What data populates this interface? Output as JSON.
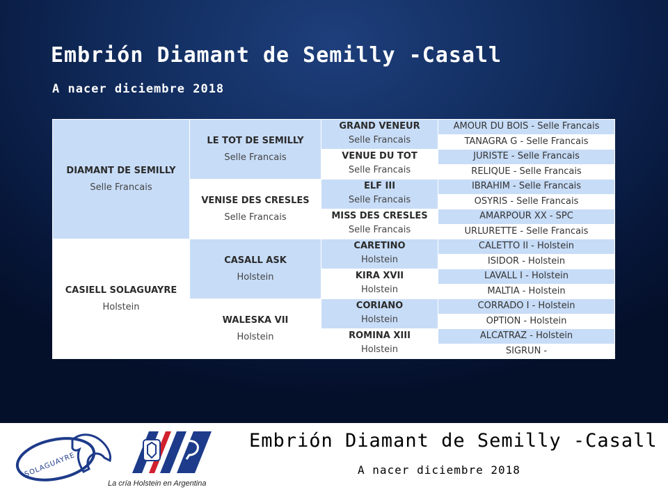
{
  "header": {
    "title": "Embrión Diamant de Semilly -Casall",
    "subtitle": "A nacer diciembre 2018"
  },
  "pedigree": {
    "sire": {
      "name": "DIAMANT DE SEMILLY",
      "breed": "Selle Francais"
    },
    "dam": {
      "name": "CASIELL SOLAGUAYRE",
      "breed": "Holstein"
    },
    "gen2": [
      {
        "name": "LE TOT DE SEMILLY",
        "breed": "Selle Francais"
      },
      {
        "name": "VENISE DES CRESLES",
        "breed": "Selle Francais"
      },
      {
        "name": "CASALL ASK",
        "breed": "Holstein"
      },
      {
        "name": "WALESKA VII",
        "breed": "Holstein"
      }
    ],
    "gen3": [
      {
        "name": "GRAND VENEUR",
        "breed": "Selle Francais"
      },
      {
        "name": "VENUE DU TOT",
        "breed": "Selle Francais"
      },
      {
        "name": "ELF III",
        "breed": "Selle Francais"
      },
      {
        "name": "MISS DES CRESLES",
        "breed": "Selle Francais"
      },
      {
        "name": "CARETINO",
        "breed": "Holstein"
      },
      {
        "name": "KIRA XVII",
        "breed": "Holstein"
      },
      {
        "name": "CORIANO",
        "breed": "Holstein"
      },
      {
        "name": "ROMINA XIII",
        "breed": "Holstein"
      }
    ],
    "gen4": [
      "AMOUR DU BOIS - Selle Francais",
      "TANAGRA G - Selle Francais",
      "JURISTE - Selle Francais",
      "RELIQUE - Selle Francais",
      "IBRAHIM - Selle Francais",
      "OSYRIS - Selle Francais",
      "AMARPOUR XX - SPC",
      "URLURETTE - Selle Francais",
      "CALETTO II - Holstein",
      "ISIDOR - Holstein",
      "LAVALL I - Holstein",
      "MALTIA - Holstein",
      "CORRADO I - Holstein",
      "OPTION - Holstein",
      "ALCATRAZ - Holstein",
      "SIGRUN -"
    ]
  },
  "footer": {
    "title": "Embrión Diamant de Semilly -Casall",
    "subtitle": "A nacer diciembre 2018",
    "logo_left_text": "SOLAGUAYRE",
    "logo_right_tagline": "La cría Holstein en Argentina"
  },
  "colors": {
    "background_top": "#1e3f7c",
    "background_bottom": "#040f29",
    "cell_blue": "#c7dcf7",
    "cell_white": "#ffffff",
    "logo_navy": "#1d3b8a",
    "logo_red": "#d1202e"
  }
}
